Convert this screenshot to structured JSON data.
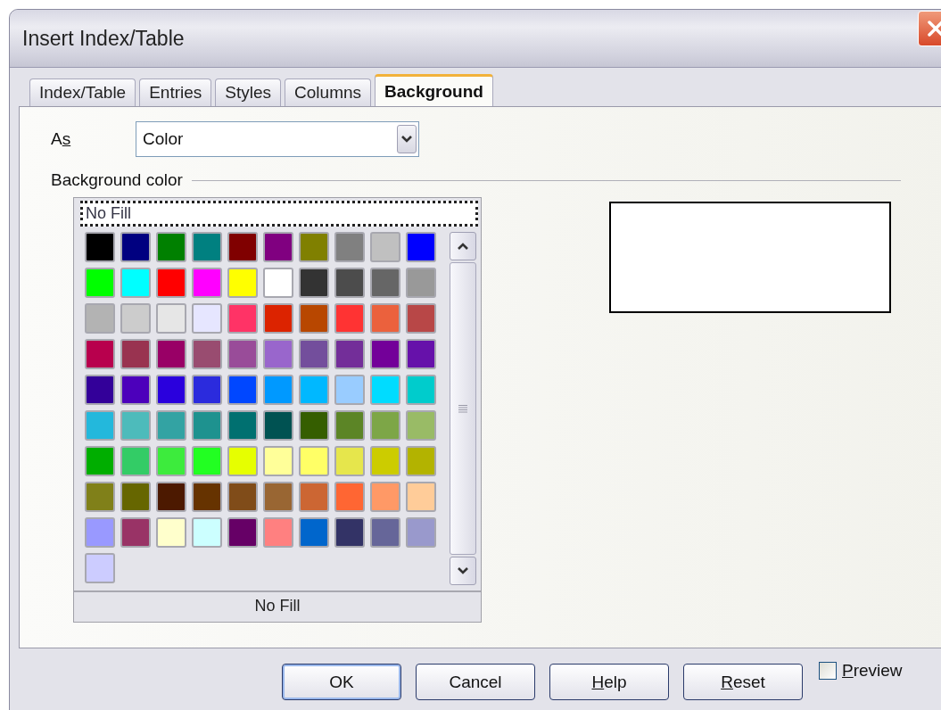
{
  "window": {
    "title": "Insert Index/Table"
  },
  "tabs": [
    {
      "label": "Index/Table",
      "selected": false
    },
    {
      "label": "Entries",
      "selected": false
    },
    {
      "label": "Styles",
      "selected": false
    },
    {
      "label": "Columns",
      "selected": false
    },
    {
      "label": "Background",
      "selected": true
    }
  ],
  "as_field": {
    "label_parts": [
      {
        "text": "A",
        "underlined": false
      },
      {
        "text": "s",
        "underlined": true
      }
    ],
    "value": "Color"
  },
  "group_title": "Background color",
  "color_list": {
    "top_entry": "No Fill",
    "bottom_label": "No Fill",
    "swatches": [
      {
        "color": "#000000"
      },
      {
        "color": "#000080"
      },
      {
        "color": "#008000"
      },
      {
        "color": "#008080"
      },
      {
        "color": "#800000"
      },
      {
        "color": "#800080"
      },
      {
        "color": "#808000"
      },
      {
        "color": "#808080"
      },
      {
        "color": "#c0c0c0"
      },
      {
        "color": "#0000ff"
      },
      {
        "color": "#00ff00"
      },
      {
        "color": "#00ffff"
      },
      {
        "color": "#ff0000"
      },
      {
        "color": "#ff00ff"
      },
      {
        "color": "#ffff00"
      },
      {
        "color": "#ffffff"
      },
      {
        "color": "#333333"
      },
      {
        "color": "#4c4c4c"
      },
      {
        "color": "#666666"
      },
      {
        "color": "#999999"
      },
      {
        "color": "#b3b3b3"
      },
      {
        "color": "#cccccc"
      },
      {
        "color": "#e6e6e6"
      },
      {
        "color": "#e6e6ff"
      },
      {
        "color": "#ff3366"
      },
      {
        "color": "#dc2300"
      },
      {
        "color": "#b84700"
      },
      {
        "color": "#ff3333"
      },
      {
        "color": "#eb613d"
      },
      {
        "color": "#b84747"
      },
      {
        "color": "#b8004d"
      },
      {
        "color": "#993350"
      },
      {
        "color": "#990066"
      },
      {
        "color": "#994c70"
      },
      {
        "color": "#994c99"
      },
      {
        "color": "#9966cc"
      },
      {
        "color": "#734e9c"
      },
      {
        "color": "#732e99"
      },
      {
        "color": "#730099"
      },
      {
        "color": "#6611aa"
      },
      {
        "color": "#330099"
      },
      {
        "color": "#4c00bb"
      },
      {
        "color": "#2a00dd"
      },
      {
        "color": "#2b2bdd"
      },
      {
        "color": "#0047ff"
      },
      {
        "color": "#0099ff"
      },
      {
        "color": "#00b8ff"
      },
      {
        "color": "#99ccff"
      },
      {
        "color": "#00dcff"
      },
      {
        "color": "#00cccc"
      },
      {
        "color": "#23b8dc"
      },
      {
        "color": "#4dbbbb"
      },
      {
        "color": "#33a3a3"
      },
      {
        "color": "#1e928f"
      },
      {
        "color": "#007070"
      },
      {
        "color": "#005252"
      },
      {
        "color": "#355e00"
      },
      {
        "color": "#5c8526"
      },
      {
        "color": "#7da647"
      },
      {
        "color": "#99bb66"
      },
      {
        "color": "#00ae00"
      },
      {
        "color": "#33cc66"
      },
      {
        "color": "#3deb3d"
      },
      {
        "color": "#22ff22"
      },
      {
        "color": "#e6ff00"
      },
      {
        "color": "#ffff99"
      },
      {
        "color": "#ffff66"
      },
      {
        "color": "#e6e64c"
      },
      {
        "color": "#cccc00"
      },
      {
        "color": "#b3b300"
      },
      {
        "color": "#808019"
      },
      {
        "color": "#666600"
      },
      {
        "color": "#4c1900"
      },
      {
        "color": "#663300"
      },
      {
        "color": "#804c19"
      },
      {
        "color": "#996633"
      },
      {
        "color": "#cc6633"
      },
      {
        "color": "#ff6633"
      },
      {
        "color": "#ff9966"
      },
      {
        "color": "#ffcc99"
      },
      {
        "color": "#9999ff"
      },
      {
        "color": "#993366"
      },
      {
        "color": "#ffffcc"
      },
      {
        "color": "#ccffff"
      },
      {
        "color": "#660066"
      },
      {
        "color": "#ff8080"
      },
      {
        "color": "#0066cc"
      },
      {
        "color": "#333366"
      },
      {
        "color": "#666699"
      },
      {
        "color": "#9999cc"
      },
      {
        "color": "#ccccff"
      }
    ]
  },
  "buttons": [
    {
      "label": "OK",
      "kind": "default"
    },
    {
      "label": "Cancel",
      "kind": "normal"
    },
    {
      "label_parts": [
        {
          "text": "H",
          "underlined": true
        },
        {
          "text": "elp",
          "underlined": false
        }
      ],
      "kind": "normal"
    },
    {
      "label_parts": [
        {
          "text": "R",
          "underlined": true
        },
        {
          "text": "eset",
          "underlined": false
        }
      ],
      "kind": "normal"
    }
  ],
  "preview": {
    "label_parts": [
      {
        "text": "P",
        "underlined": true
      },
      {
        "text": "review",
        "underlined": false
      }
    ],
    "checked": false
  }
}
